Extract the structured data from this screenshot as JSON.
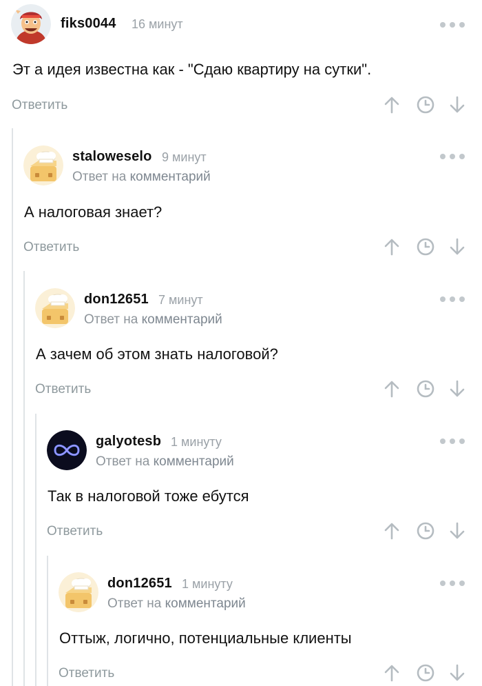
{
  "comments": [
    {
      "author": "fiks0044",
      "time": "16 минут",
      "reply_prefix": "",
      "reply_link": "",
      "text": "Эт а идея известна как - \"Сдаю квартиру на сутки\".",
      "reply_label": "Ответить",
      "avatar": "cartoon-man-avatar"
    },
    {
      "author": "staloweselo",
      "time": "9 минут",
      "reply_prefix": "Ответ на",
      "reply_link": "комментарий",
      "text": "А налоговая знает?",
      "reply_label": "Ответить",
      "avatar": "chef-hat-avatar"
    },
    {
      "author": "don12651",
      "time": "7 минут",
      "reply_prefix": "Ответ на",
      "reply_link": "комментарий",
      "text": "А зачем об этом знать налоговой?",
      "reply_label": "Ответить",
      "avatar": "chef-hat-avatar"
    },
    {
      "author": "galyotesb",
      "time": "1 минуту",
      "reply_prefix": "Ответ на",
      "reply_link": "комментарий",
      "text": "Так в налоговой тоже ебутся",
      "reply_label": "Ответить",
      "avatar": "infinity-avatar"
    },
    {
      "author": "don12651",
      "time": "1 минуту",
      "reply_prefix": "Ответ на",
      "reply_link": "комментарий",
      "text": "Оттыж, логично, потенциальные клиенты",
      "reply_label": "Ответить",
      "avatar": "chef-hat-avatar"
    }
  ],
  "icons": {
    "more": "more-dots-icon",
    "upvote": "arrow-up-icon",
    "history": "clock-icon",
    "downvote": "arrow-down-icon"
  },
  "colors": {
    "text": "#111111",
    "muted": "#9aa1a7",
    "icon": "#b5bcc1",
    "thread_line": "#dfe3e6"
  }
}
